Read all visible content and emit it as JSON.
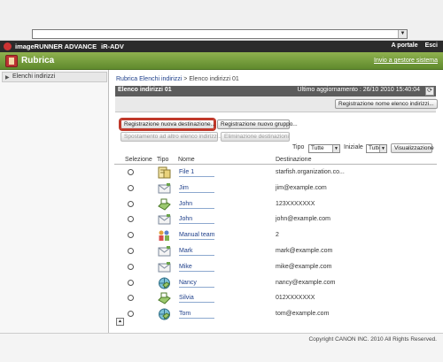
{
  "header": {
    "brand": "imageRUNNER ADVANCE",
    "model": "iR-ADV",
    "links": [
      "A portale",
      "Esci"
    ]
  },
  "titlebar": {
    "title": "Rubrica",
    "send_link": "Invio a gestore sistema"
  },
  "sidebar": {
    "items": [
      {
        "label": "Elenchi indirizzi"
      }
    ]
  },
  "breadcrumb": {
    "part1": "Rubrica",
    "part2": "Elenchi indirizzi",
    "sep": ">",
    "current": "Elenco indirizzi 01"
  },
  "panel": {
    "title": "Elenco indirizzi 01",
    "updated": "Ultimo aggiornamento : 26/10 2010 15:40:04",
    "register_name_button": "Registrazione nome elenco indirizzi..."
  },
  "actions": {
    "new_destination": "Registrazione nuova destinazione...",
    "new_group": "Registrazione nuovo gruppo...",
    "move_to_list": "Spostamento ad altro elenco indirizzi...",
    "delete_destination": "Eliminazione destinazioni"
  },
  "filters": {
    "type_label": "Tipo",
    "type_value": "Tutte",
    "initial_label": "Iniziale",
    "initial_value": "Tutte",
    "view_button": "Visualizzazione"
  },
  "table": {
    "headers": [
      "Selezione",
      "Tipo",
      "Nome",
      "Destinazione"
    ],
    "rows": [
      {
        "icon": "file-server-icon",
        "name": "File 1",
        "destination": "starfish.organization.co..."
      },
      {
        "icon": "email-icon",
        "name": "Jim",
        "destination": "jim@example.com"
      },
      {
        "icon": "fax-icon",
        "name": "John",
        "destination": "123XXXXXXX"
      },
      {
        "icon": "email-icon",
        "name": "John",
        "destination": "john@example.com"
      },
      {
        "icon": "group-icon",
        "name": "Manual team",
        "destination": "2"
      },
      {
        "icon": "email-icon",
        "name": "Mark",
        "destination": "mark@example.com"
      },
      {
        "icon": "email-icon",
        "name": "Mike",
        "destination": "mike@example.com"
      },
      {
        "icon": "internet-fax-icon",
        "name": "Nancy",
        "destination": "nancy@example.com"
      },
      {
        "icon": "fax-icon",
        "name": "Silvia",
        "destination": "012XXXXXXX"
      },
      {
        "icon": "internet-fax-icon",
        "name": "Tom",
        "destination": "tom@example.com"
      }
    ]
  },
  "footer": {
    "copyright": "Copyright CANON INC. 2010 All Rights Reserved."
  },
  "colors": {
    "title_green": "#6f9a3a",
    "header_dark": "#2b2b2b",
    "link_blue": "#1e3f8a",
    "highlight_red": "#c0392b"
  }
}
